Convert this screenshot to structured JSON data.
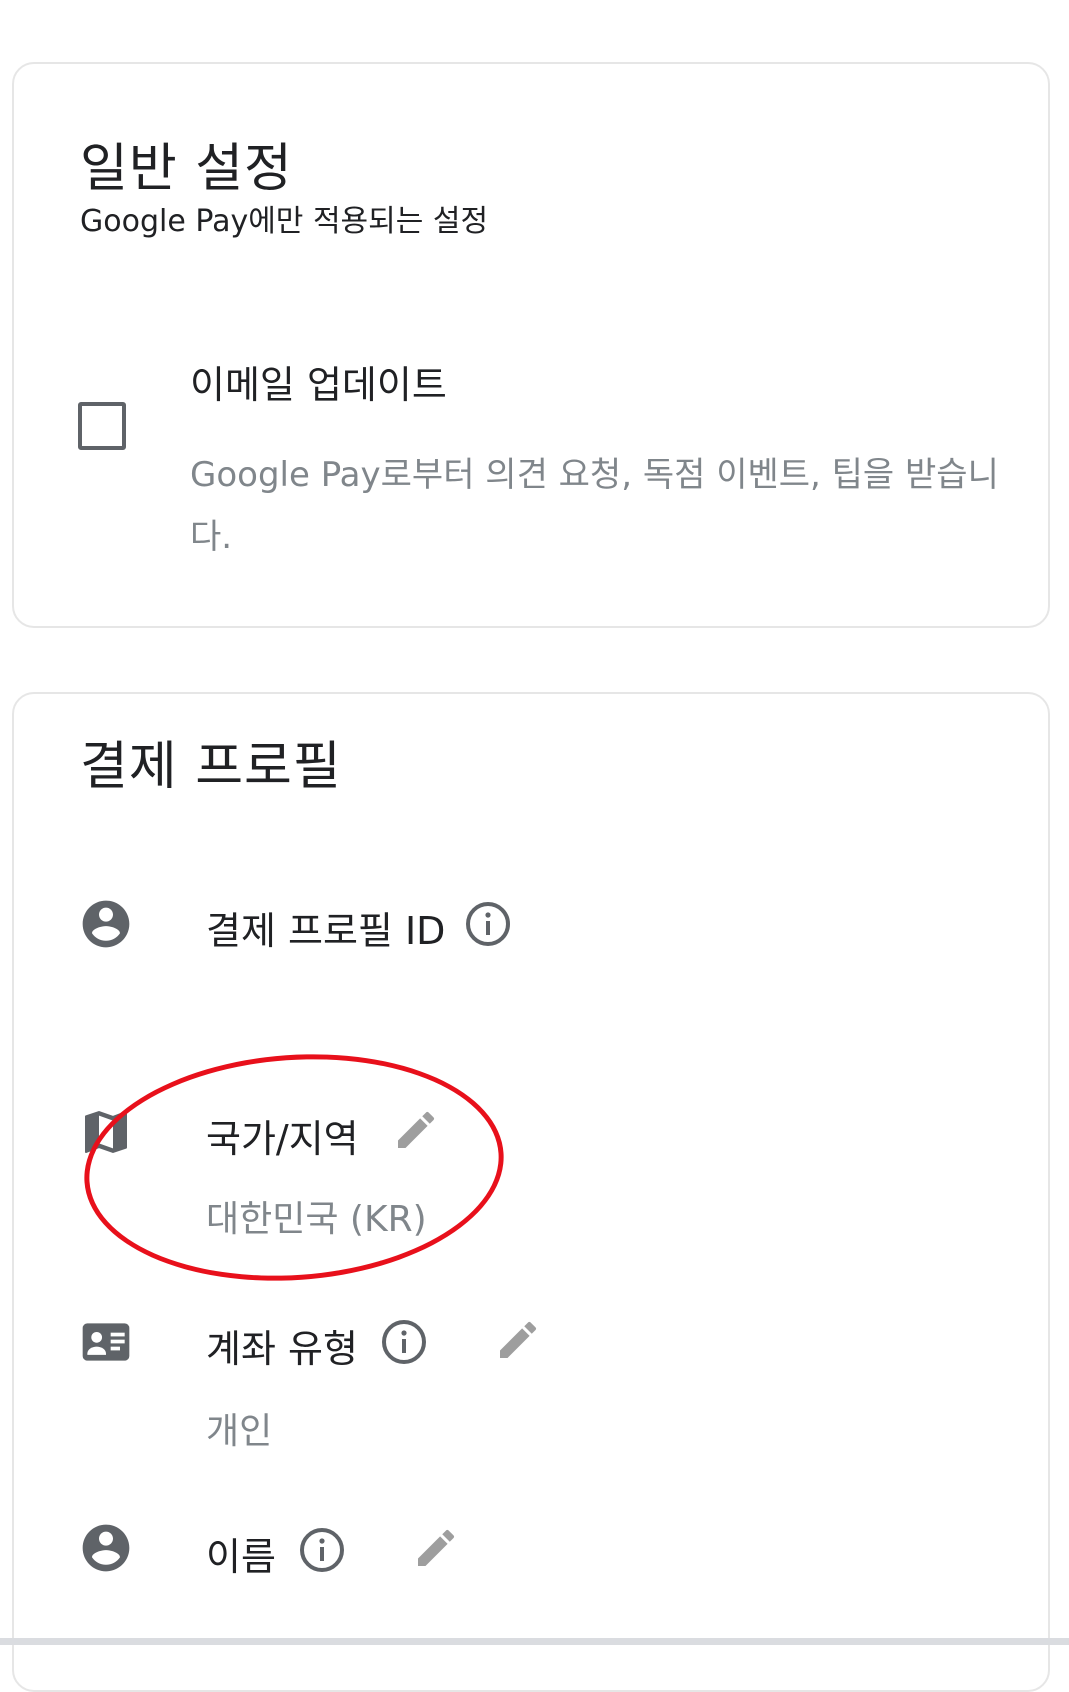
{
  "general_settings": {
    "title": "일반 설정",
    "subtitle": "Google Pay에만 적용되는 설정",
    "email_updates": {
      "title": "이메일 업데이트",
      "description": "Google Pay로부터 의견 요청, 독점 이벤트, 팁을 받습니다.",
      "checked": false
    }
  },
  "payments_profile": {
    "title": "결제 프로필",
    "profile_id": {
      "label": "결제 프로필 ID",
      "icon": "account-circle-icon"
    },
    "country": {
      "label": "국가/지역",
      "value": "대한민국 (KR)",
      "icon": "map-icon"
    },
    "account_type": {
      "label": "계좌 유형",
      "value": "개인",
      "icon": "contact-card-icon"
    },
    "name": {
      "label": "이름",
      "icon": "account-circle-icon"
    }
  },
  "colors": {
    "annotation": "#e8101b",
    "icon": "#5f6368",
    "edit_icon": "#9e9e9e",
    "secondary_text": "#80868b"
  }
}
